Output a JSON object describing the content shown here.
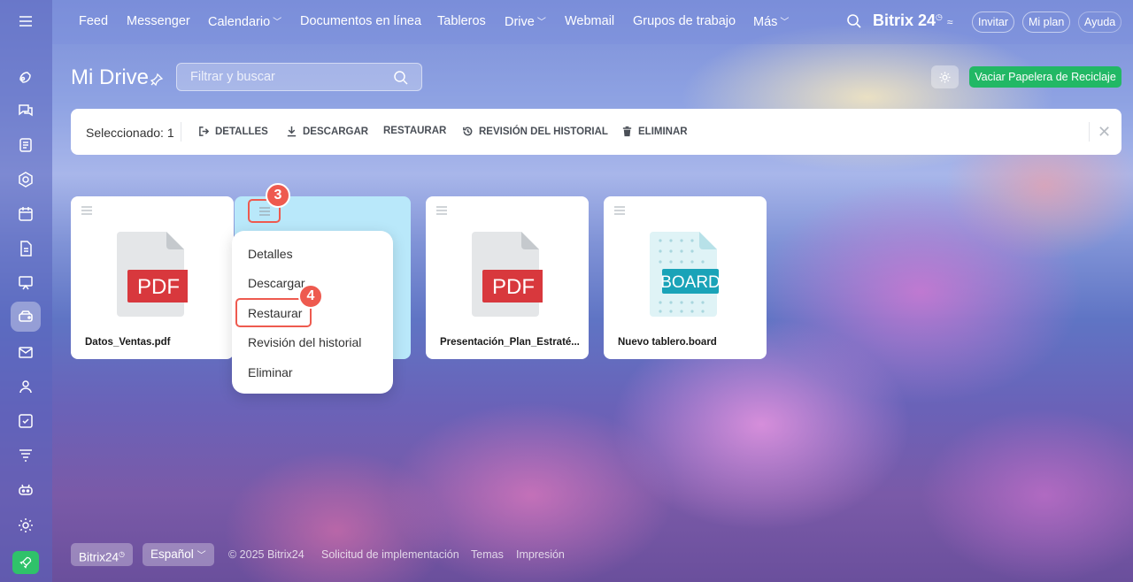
{
  "nav": {
    "items": [
      "Feed",
      "Messenger",
      "Calendario",
      "Documentos en línea",
      "Tableros",
      "Drive",
      "Webmail",
      "Grupos de trabajo",
      "Más"
    ],
    "brand": "Bitrix 24",
    "invite": "Invitar",
    "my_plan": "Mi plan",
    "help": "Ayuda"
  },
  "header": {
    "title": "Mi Drive",
    "search_placeholder": "Filtrar y buscar",
    "empty_trash": "Vaciar Papelera de Reciclaje"
  },
  "action_bar": {
    "selected": "Seleccionado: 1",
    "details": "DETALLES",
    "download": "DESCARGAR",
    "restore": "RESTAURAR",
    "history": "REVISIÓN DEL HISTORIAL",
    "delete": "ELIMINAR"
  },
  "files": [
    {
      "name": "Datos_Ventas.pdf",
      "type": "PDF"
    },
    {
      "name": "",
      "type": ""
    },
    {
      "name": "Presentación_Plan_Estraté...",
      "type": "PDF"
    },
    {
      "name": "Nuevo tablero.board",
      "type": "BOARD"
    }
  ],
  "context_menu": [
    "Detalles",
    "Descargar",
    "Restaurar",
    "Revisión del historial",
    "Eliminar"
  ],
  "steps": [
    "3",
    "4"
  ],
  "footer": {
    "brand": "Bitrix24",
    "language": "Español",
    "copyright": "© 2025 Bitrix24",
    "implementation": "Solicitud de implementación",
    "themes": "Temas",
    "print": "Impresión"
  },
  "colors": {
    "accent_green": "#22b865",
    "pdf_red": "#d8383d",
    "board_teal": "#1aa3b8",
    "callout_red": "#ee5a4f"
  }
}
